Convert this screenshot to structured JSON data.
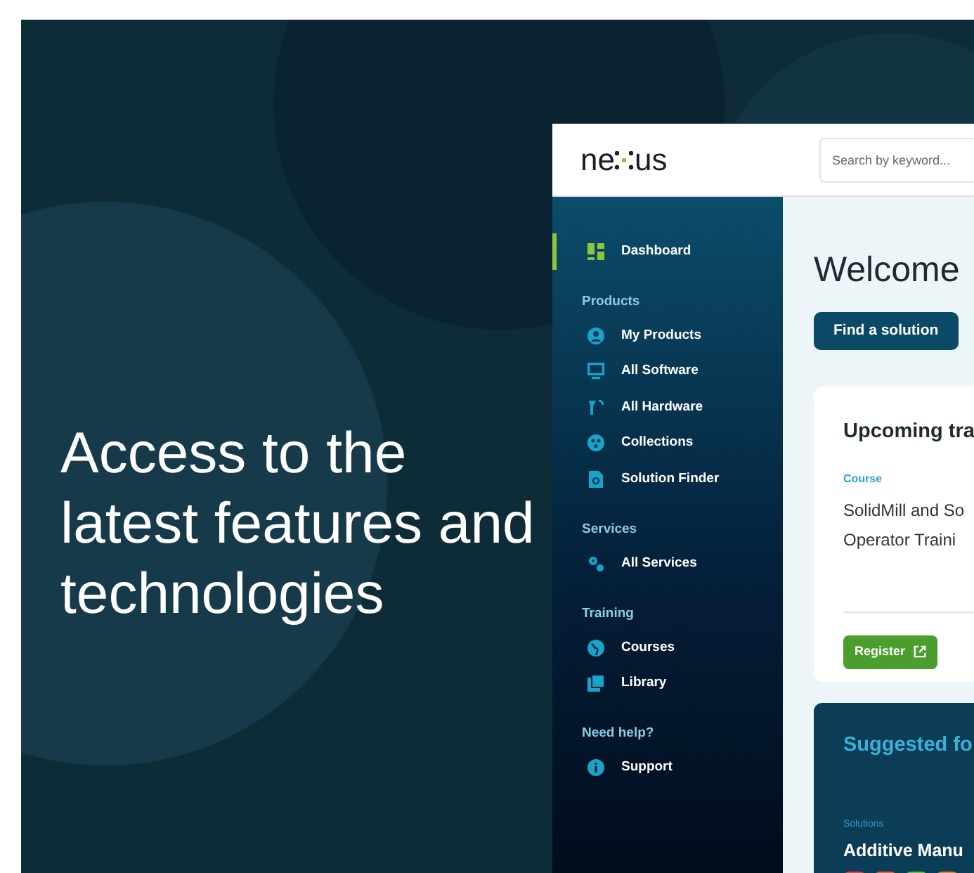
{
  "headline": "Access to the latest features and technologies",
  "app": {
    "logo": {
      "before": "ne",
      "after": "us"
    },
    "search": {
      "placeholder": "Search by keyword..."
    },
    "sidebar": [
      {
        "items": [
          {
            "label": "Dashboard",
            "kind": "dashboard",
            "selected": true
          }
        ]
      },
      {
        "heading": "Products",
        "items": [
          {
            "label": "My Products",
            "kind": "person",
            "selected": false
          },
          {
            "label": "All Software",
            "kind": "monitor",
            "selected": false
          },
          {
            "label": "All Hardware",
            "kind": "hardware",
            "selected": false
          },
          {
            "label": "Collections",
            "kind": "collections",
            "selected": false
          },
          {
            "label": "Solution Finder",
            "kind": "finder",
            "selected": false
          }
        ]
      },
      {
        "heading": "Services",
        "items": [
          {
            "label": "All Services",
            "kind": "gears",
            "selected": false
          }
        ]
      },
      {
        "heading": "Training",
        "items": [
          {
            "label": "Courses",
            "kind": "globe",
            "selected": false
          },
          {
            "label": "Library",
            "kind": "library",
            "selected": false
          }
        ]
      },
      {
        "heading": "Need help?",
        "items": [
          {
            "label": "Support",
            "kind": "info",
            "selected": false
          }
        ]
      }
    ],
    "main": {
      "title": "Welcome",
      "button": "Find a solution",
      "training_card": {
        "title": "Upcoming tra",
        "tag": "Course",
        "lines": [
          "SolidMill and So",
          "Operator Traini"
        ],
        "button": "Register"
      },
      "suggested_card": {
        "title": "Suggested fo",
        "tag": "Solutions",
        "name": "Additive Manu",
        "tiles": [
          {
            "color": "#e0474c"
          },
          {
            "color": "#e8663a"
          },
          {
            "color": "#6cbf4a"
          },
          {
            "color": "#e8823a"
          }
        ]
      }
    }
  }
}
